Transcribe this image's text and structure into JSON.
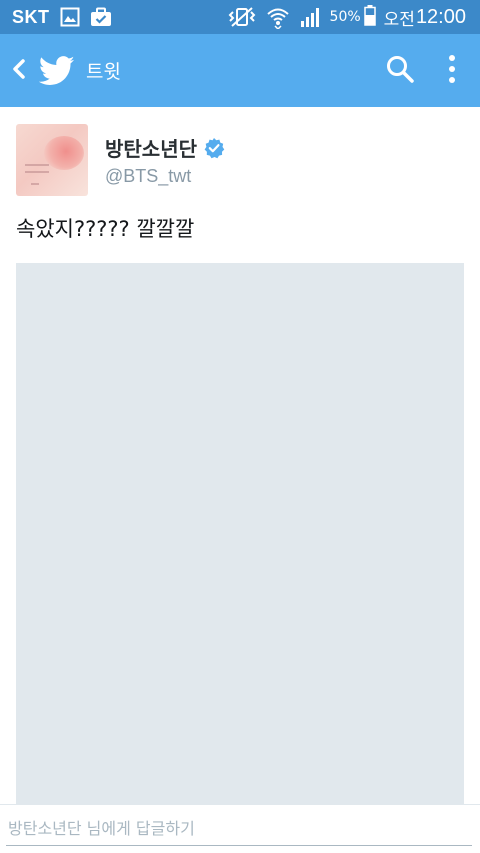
{
  "status_bar": {
    "carrier": "SKT",
    "battery_percent": "50%",
    "time_prefix": "오전",
    "time": "12:00"
  },
  "app_bar": {
    "title": "트윗",
    "icons": [
      "back-arrow-icon",
      "twitter-bird-icon",
      "search-icon",
      "more-vertical-icon"
    ]
  },
  "tweet": {
    "author_name": "방탄소년단",
    "author_handle": "@BTS_twt",
    "verified": true,
    "text": "속았지????? 깔깔깔"
  },
  "reply": {
    "placeholder": "방탄소년단 님에게 답글하기"
  },
  "colors": {
    "status_bar": "#3c89c9",
    "app_bar": "#55acee",
    "media_placeholder": "#e1e8ed",
    "handle": "#8899a6",
    "verified": "#55acee"
  }
}
